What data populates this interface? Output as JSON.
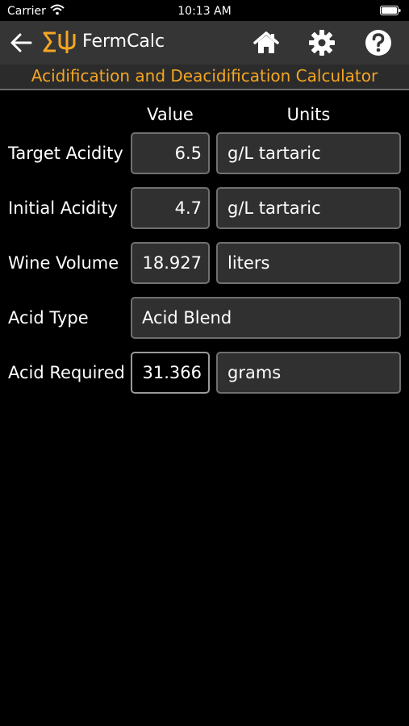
{
  "status_bar": {
    "carrier": "Carrier",
    "time": "10:13 AM"
  },
  "nav": {
    "app_name": "FermCalc"
  },
  "subtitle": "Acidification and Deacidification Calculator",
  "columns": {
    "value": "Value",
    "units": "Units"
  },
  "rows": {
    "target_acidity": {
      "label": "Target Acidity",
      "value": "6.5",
      "units": "g/L tartaric"
    },
    "initial_acidity": {
      "label": "Initial Acidity",
      "value": "4.7",
      "units": "g/L tartaric"
    },
    "wine_volume": {
      "label": "Wine Volume",
      "value": "18.927",
      "units": "liters"
    },
    "acid_type": {
      "label": "Acid Type",
      "value": "Acid Blend"
    },
    "acid_required": {
      "label": "Acid Required",
      "value": "31.366",
      "units": "grams"
    }
  },
  "colors": {
    "accent": "#f5a623",
    "navbar": "#353535",
    "field": "#303030",
    "border": "#707070"
  },
  "icons": [
    "wifi-icon",
    "battery-icon",
    "back-arrow-icon",
    "fermcalc-logo-icon",
    "home-icon",
    "gear-icon",
    "help-icon"
  ]
}
